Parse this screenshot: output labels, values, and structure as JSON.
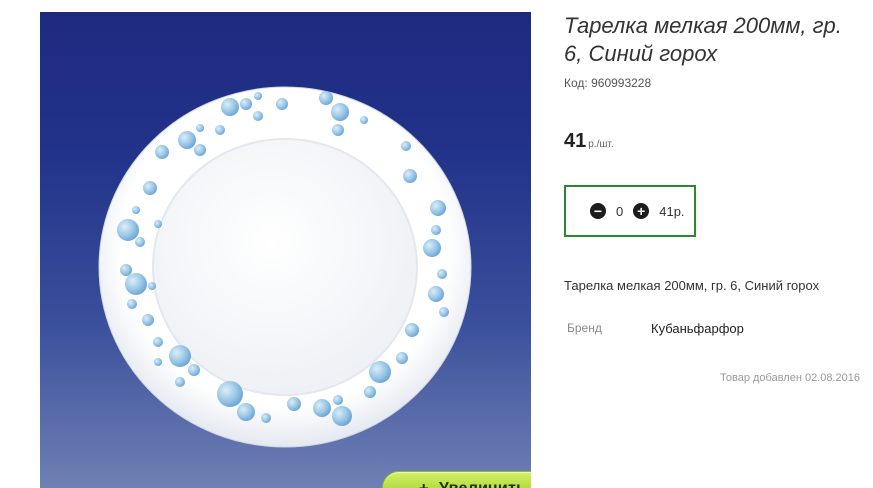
{
  "product": {
    "title": "Тарелка мелкая 200мм, гр. 6, Синий горох",
    "code_label": "Код:",
    "code": "960993228",
    "price": "41",
    "price_unit": "р./шт.",
    "description": "Тарелка мелкая 200мм, гр. 6, Синий горох",
    "attribute_label": "Бренд",
    "attribute_value": "Кубаньфарфор",
    "added_text": "Товар добавлен 02.08.2016"
  },
  "cart": {
    "minus_icon": "minus-circle-icon",
    "plus_icon": "plus-circle-icon",
    "quantity": "0",
    "total": "41р."
  },
  "gallery": {
    "zoom_plus": "+",
    "zoom_label": "Увеличить",
    "plate_pattern": "blue polka dots",
    "background_color": "#1d2a80",
    "button_color": "#b2dc3c"
  },
  "colors": {
    "accent_border": "#2b8a2b"
  }
}
